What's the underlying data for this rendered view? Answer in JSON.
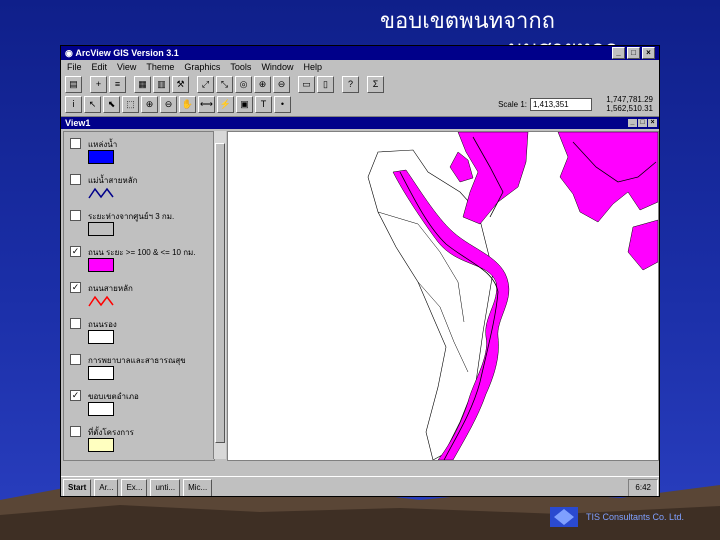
{
  "slide": {
    "title_line1": "ขอบเขตพนทจากถ",
    "title_line2": "นนสายหลก"
  },
  "window": {
    "title": "ArcView GIS Version 3.1"
  },
  "menu": [
    "File",
    "Edit",
    "View",
    "Theme",
    "Graphics",
    "Tools",
    "Window",
    "Help"
  ],
  "toolbar": {
    "scale_label": "Scale 1:",
    "scale_value": "1,413,351",
    "coord_x": "1,747,781.29",
    "coord_y": "1,562,510.31"
  },
  "view": {
    "title": "View1"
  },
  "layers": [
    {
      "name": "แหล่งน้ำ",
      "checked": false,
      "color": "#0000ff",
      "kind": "fill"
    },
    {
      "name": "แม่น้ำสายหลัก",
      "checked": false,
      "color": "#00008b",
      "kind": "line"
    },
    {
      "name": "ระยะห่างจากศูนย์ฯ 3 กม.",
      "checked": false,
      "color": "#c0c0c0",
      "kind": "fill"
    },
    {
      "name": "ถนน ระยะ >= 100 & <= 10 กม.",
      "checked": true,
      "color": "#ff00ff",
      "kind": "fill"
    },
    {
      "name": "ถนนสายหลัก",
      "checked": true,
      "color": "#ff0000",
      "kind": "line"
    },
    {
      "name": "ถนนรอง",
      "checked": false,
      "color": "#000000",
      "kind": "outline"
    },
    {
      "name": "การพยาบาลและสาธารณสุข",
      "checked": false,
      "color": "#000000",
      "kind": "outline"
    },
    {
      "name": "ขอบเขตอำเภอ",
      "checked": true,
      "color": "#000000",
      "kind": "outline"
    },
    {
      "name": "ที่ตั้งโครงการ",
      "checked": false,
      "color": "#ffffc0",
      "kind": "fill"
    }
  ],
  "taskbar": {
    "start": "Start",
    "tasks": [
      "Ar...",
      "Ex...",
      "unti...",
      "Mic..."
    ],
    "time": "6:42"
  },
  "footer": {
    "company": "TIS Consultants Co. Ltd."
  }
}
